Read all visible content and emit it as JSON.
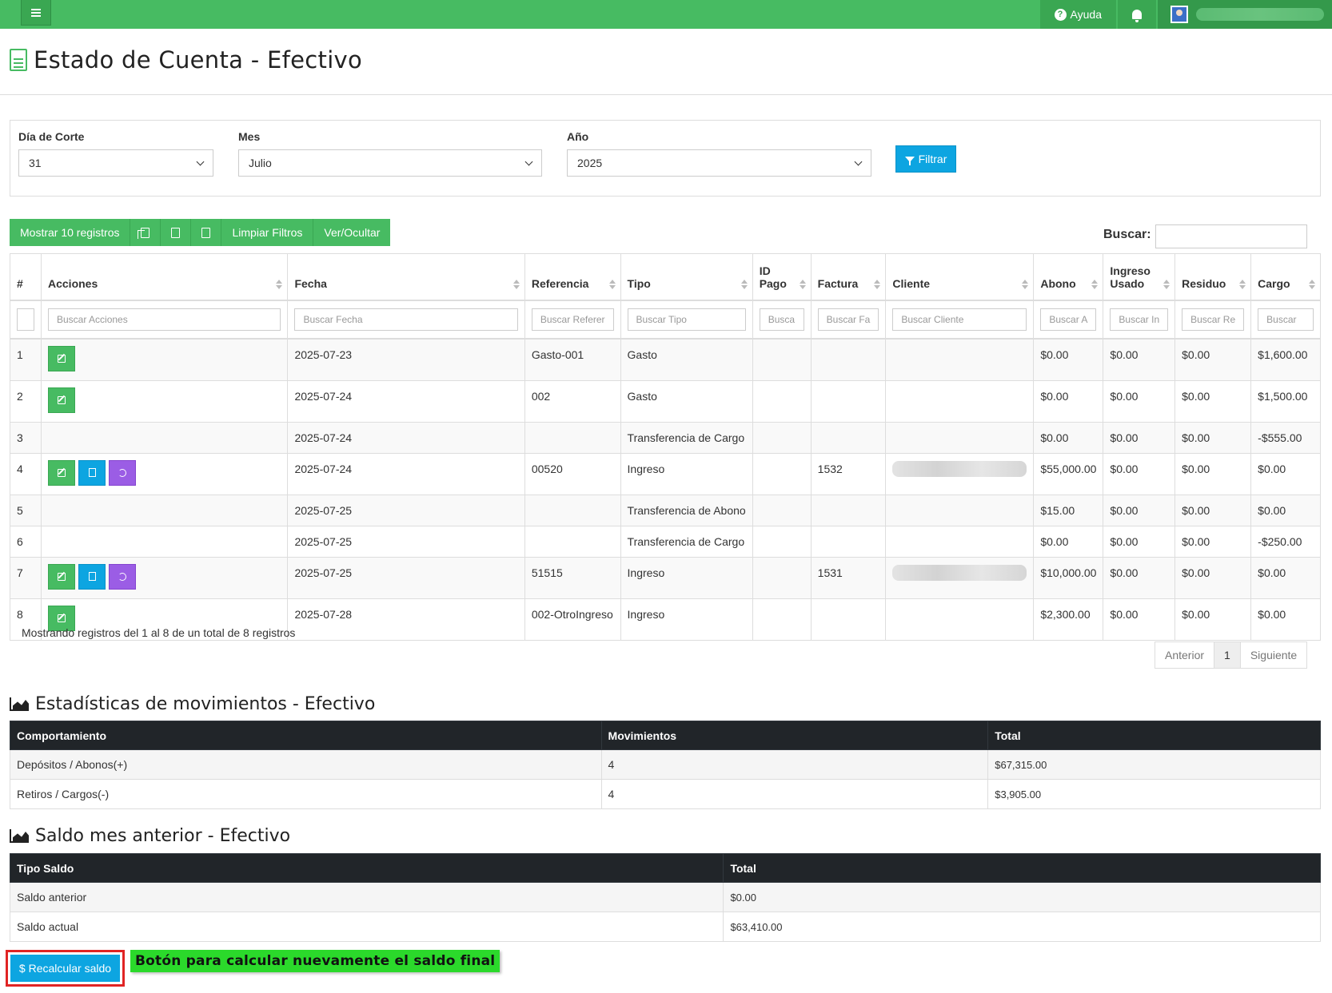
{
  "topbar": {
    "help_label": "Ayuda"
  },
  "page": {
    "title": "Estado de Cuenta - Efectivo"
  },
  "filters": {
    "dia_label": "Día de Corte",
    "dia_value": "31",
    "mes_label": "Mes",
    "mes_value": "Julio",
    "anio_label": "Año",
    "anio_value": "2025",
    "filter_button": "Filtrar"
  },
  "toolbar": {
    "show_records": "Mostrar 10 registros",
    "clear_filters": "Limpiar Filtros",
    "toggle_columns": "Ver/Ocultar",
    "search_label": "Buscar:"
  },
  "table": {
    "headers": [
      "#",
      "Acciones",
      "Fecha",
      "Referencia",
      "Tipo",
      "ID Pago",
      "Factura",
      "Cliente",
      "Abono",
      "Ingreso Usado",
      "Residuo",
      "Cargo"
    ],
    "filter_placeholders": [
      "Buscar Acciones",
      "Buscar Fecha",
      "Buscar Referer",
      "Buscar Tipo",
      "Busca",
      "Buscar Fa",
      "Buscar Cliente",
      "Buscar A",
      "Buscar In",
      "Buscar Re",
      "Buscar"
    ],
    "rows": [
      {
        "num": "1",
        "fecha": "2025-07-23",
        "referencia": "Gasto-001",
        "tipo": "Gasto",
        "id_pago": "",
        "factura": "",
        "abono": "$0.00",
        "ingreso": "$0.00",
        "residuo": "$0.00",
        "cargo": "$1,600.00"
      },
      {
        "num": "2",
        "fecha": "2025-07-24",
        "referencia": "002",
        "tipo": "Gasto",
        "id_pago": "",
        "factura": "",
        "abono": "$0.00",
        "ingreso": "$0.00",
        "residuo": "$0.00",
        "cargo": "$1,500.00"
      },
      {
        "num": "3",
        "fecha": "2025-07-24",
        "referencia": "",
        "tipo": "Transferencia de Cargo",
        "id_pago": "",
        "factura": "",
        "abono": "$0.00",
        "ingreso": "$0.00",
        "residuo": "$0.00",
        "cargo": "-$555.00"
      },
      {
        "num": "4",
        "fecha": "2025-07-24",
        "referencia": "00520",
        "tipo": "Ingreso",
        "id_pago": "",
        "factura": "1532",
        "abono": "$55,000.00",
        "ingreso": "$0.00",
        "residuo": "$0.00",
        "cargo": "$0.00"
      },
      {
        "num": "5",
        "fecha": "2025-07-25",
        "referencia": "",
        "tipo": "Transferencia de Abono",
        "id_pago": "",
        "factura": "",
        "abono": "$15.00",
        "ingreso": "$0.00",
        "residuo": "$0.00",
        "cargo": "$0.00"
      },
      {
        "num": "6",
        "fecha": "2025-07-25",
        "referencia": "",
        "tipo": "Transferencia de Cargo",
        "id_pago": "",
        "factura": "",
        "abono": "$0.00",
        "ingreso": "$0.00",
        "residuo": "$0.00",
        "cargo": "-$250.00"
      },
      {
        "num": "7",
        "fecha": "2025-07-25",
        "referencia": "51515",
        "tipo": "Ingreso",
        "id_pago": "",
        "factura": "1531",
        "abono": "$10,000.00",
        "ingreso": "$0.00",
        "residuo": "$0.00",
        "cargo": "$0.00"
      },
      {
        "num": "8",
        "fecha": "2025-07-28",
        "referencia": "002-OtroIngreso",
        "tipo": "Ingreso",
        "id_pago": "",
        "factura": "",
        "abono": "$2,300.00",
        "ingreso": "$0.00",
        "residuo": "$0.00",
        "cargo": "$0.00"
      }
    ],
    "info": "Mostrando registros del 1 al 8 de un total de 8 registros",
    "pager_prev": "Anterior",
    "pager_current": "1",
    "pager_next": "Siguiente"
  },
  "stats": {
    "title": "Estadísticas de movimientos - Efectivo",
    "headers": [
      "Comportamiento",
      "Movimientos",
      "Total"
    ],
    "rows": [
      [
        "Depósitos / Abonos(+)",
        "4",
        "$67,315.00"
      ],
      [
        "Retiros / Cargos(-)",
        "4",
        "$3,905.00"
      ]
    ]
  },
  "balance": {
    "title": "Saldo mes anterior - Efectivo",
    "headers": [
      "Tipo Saldo",
      "Total"
    ],
    "rows": [
      [
        "Saldo anterior",
        "$0.00"
      ],
      [
        "Saldo actual",
        "$63,410.00"
      ]
    ]
  },
  "recalc": {
    "button": "$ Recalcular saldo",
    "note": "Botón para calcular nuevamente el saldo final"
  }
}
